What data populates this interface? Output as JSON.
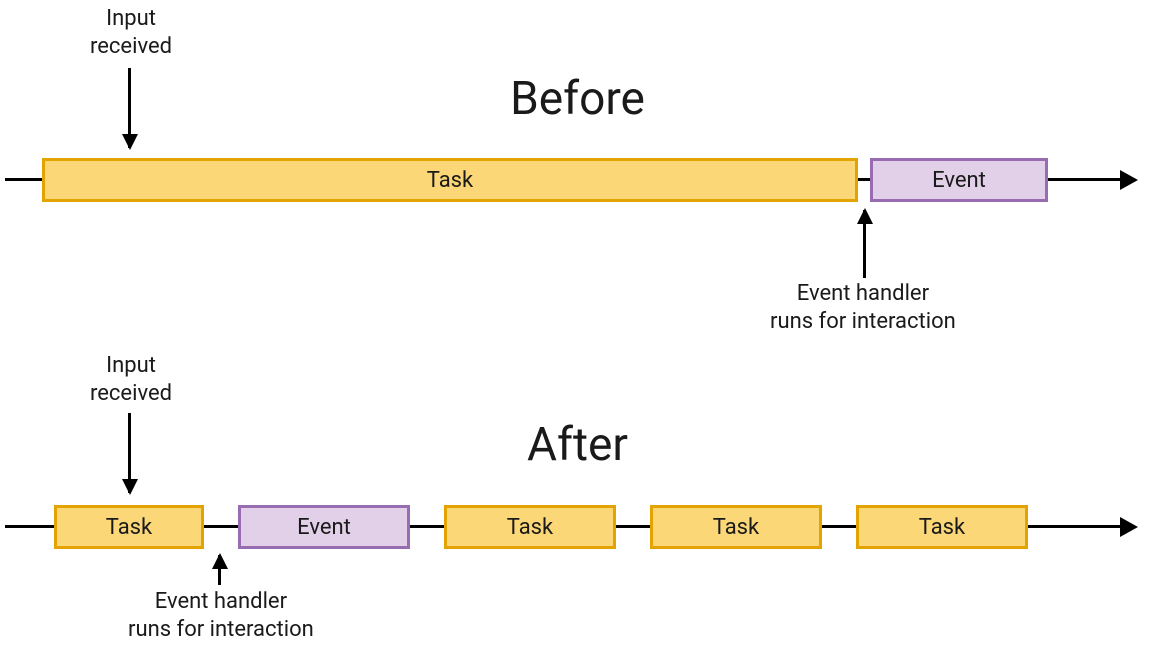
{
  "before": {
    "heading": "Before",
    "input_label": "Input\nreceived",
    "task_label": "Task",
    "event_label": "Event",
    "handler_label": "Event handler\nruns for interaction"
  },
  "after": {
    "heading": "After",
    "input_label": "Input\nreceived",
    "task1_label": "Task",
    "event_label": "Event",
    "task2_label": "Task",
    "task3_label": "Task",
    "task4_label": "Task",
    "handler_label": "Event handler\nruns for interaction"
  },
  "colors": {
    "task_fill": "#fbd778",
    "task_border": "#e3a300",
    "event_fill": "#e2d0e8",
    "event_border": "#986cb0"
  }
}
